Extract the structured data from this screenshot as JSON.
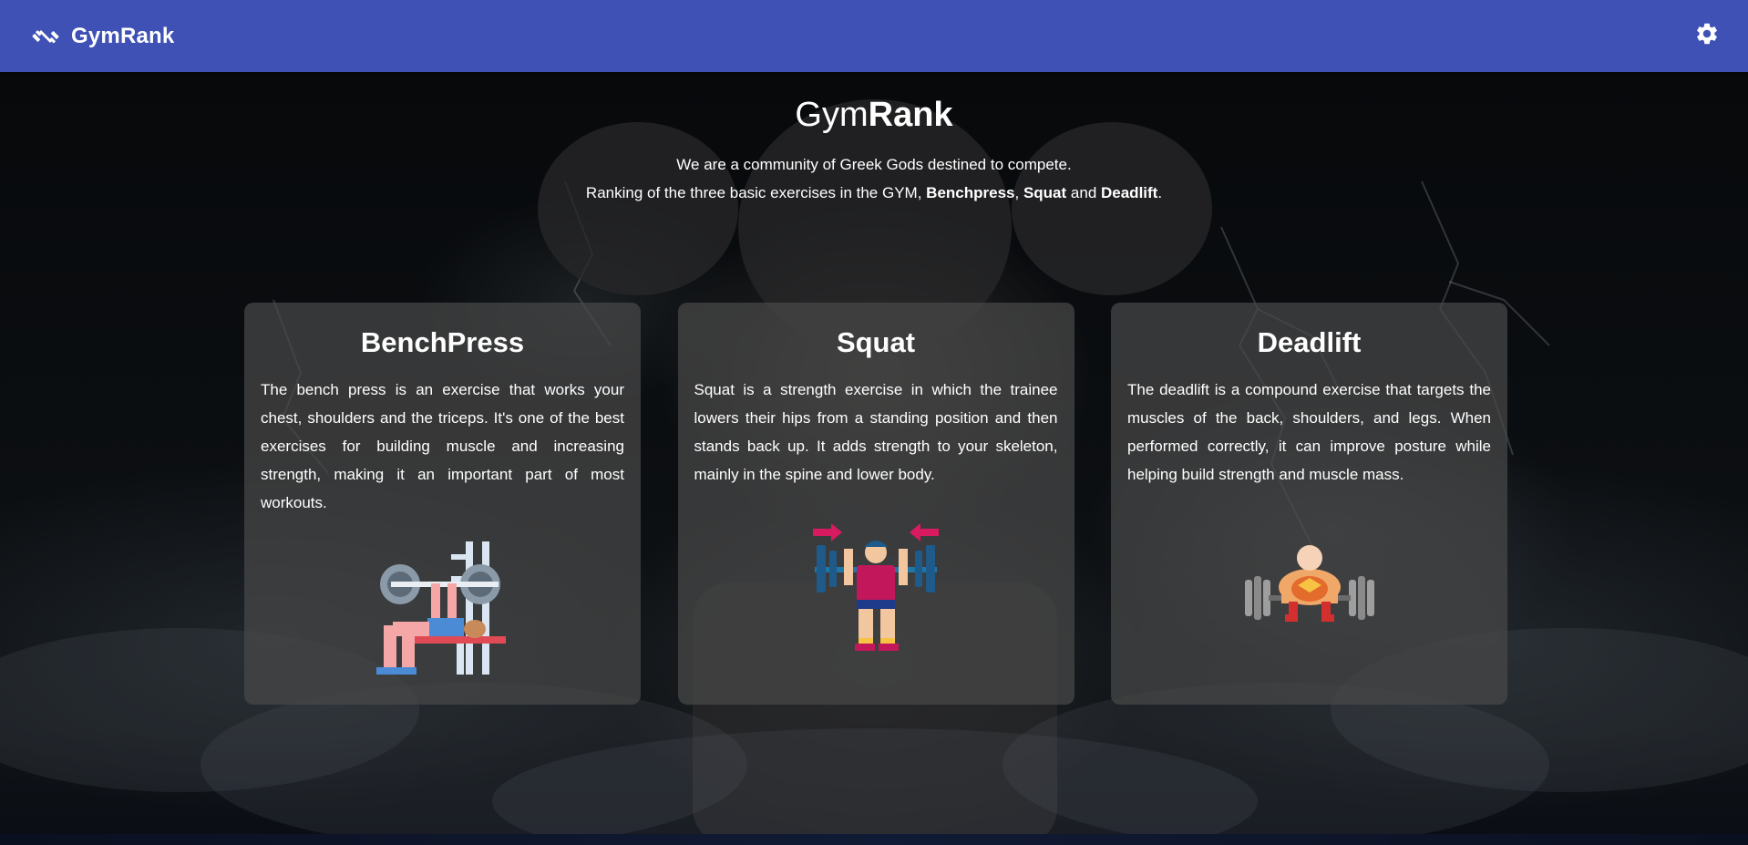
{
  "header": {
    "brand": "GymRank",
    "brand_icon": "dumbbell-icon",
    "settings_icon": "gear-icon",
    "bar_color": "#3f51b5"
  },
  "intro": {
    "title_light": "Gym",
    "title_bold": "Rank",
    "line1": "We are a community of Greek Gods destined to compete.",
    "line2_prefix": "Ranking of the three basic exercises in the GYM, ",
    "exercise1": "Benchpress",
    "sep1": ", ",
    "exercise2": "Squat",
    "sep2": " and ",
    "exercise3": "Deadlift",
    "suffix": "."
  },
  "cards": [
    {
      "title": "BenchPress",
      "description": "The bench press is an exercise that works your chest, shoulders and the triceps. It's one of the best exercises for building muscle and increasing strength, making it an important part of most workouts.",
      "icon": "bench-press-icon"
    },
    {
      "title": "Squat",
      "description": "Squat is a strength exercise in which the trainee lowers their hips from a standing position and then stands back up. It adds strength to your skeleton, mainly in the spine and lower body.",
      "icon": "squat-icon"
    },
    {
      "title": "Deadlift",
      "description": "The deadlift is a compound exercise that targets the muscles of the back, shoulders, and legs. When performed correctly, it can improve posture while helping build strength and muscle mass.",
      "icon": "deadlift-icon"
    }
  ]
}
